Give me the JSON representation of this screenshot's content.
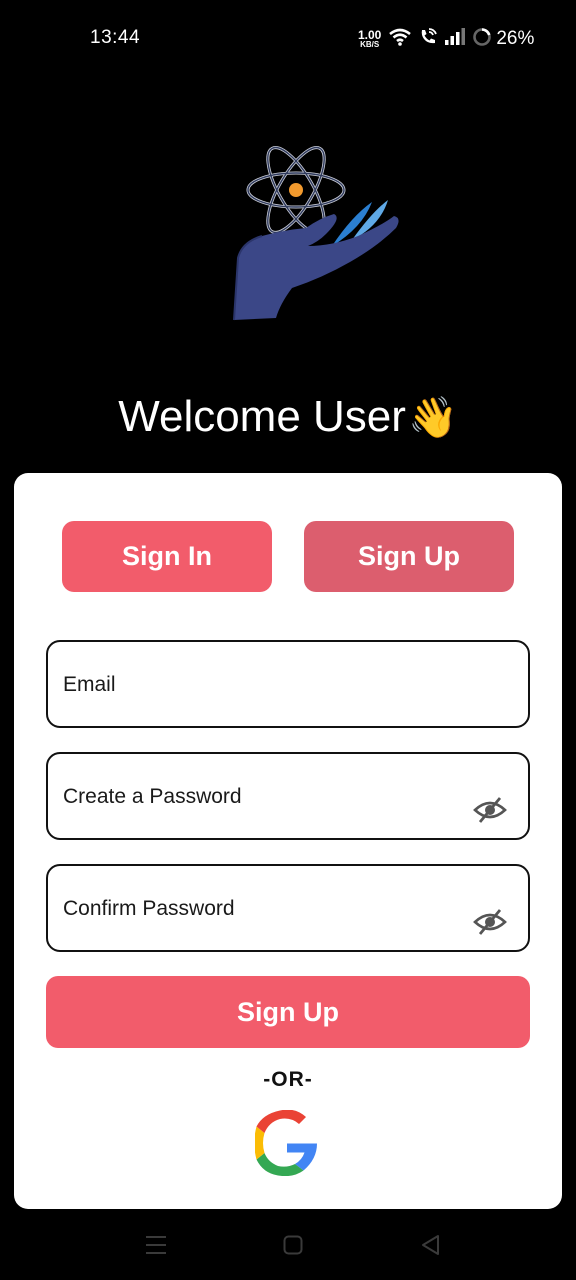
{
  "status_bar": {
    "time": "13:44",
    "net_speed_value": "1.00",
    "net_speed_unit": "KB/S",
    "battery": "26%",
    "icons": [
      "wifi-icon",
      "wifi-call-icon",
      "signal-icon",
      "battery-ring-icon"
    ]
  },
  "logo": {
    "icon": "science-hand-logo"
  },
  "welcome": {
    "title": "Welcome User",
    "emoji": "👋"
  },
  "tabs": {
    "sign_in": "Sign In",
    "sign_up": "Sign Up"
  },
  "form": {
    "email_placeholder": "Email",
    "password_placeholder": "Create a Password",
    "confirm_placeholder": "Confirm Password",
    "submit_label": "Sign Up",
    "or_text": "-OR-"
  },
  "colors": {
    "accent": "#f25c6b",
    "accent_secondary": "#dc5e6e",
    "background": "#000000",
    "card": "#ffffff"
  },
  "nav_bar": {
    "icons": [
      "menu-icon",
      "home-icon",
      "back-icon"
    ]
  }
}
